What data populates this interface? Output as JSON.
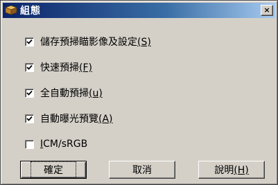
{
  "window": {
    "title": "組態",
    "close_label": "×"
  },
  "options": [
    {
      "label_prefix": "儲存預掃瞄影像及設定",
      "mnemonic": "(S)",
      "checked": true
    },
    {
      "label_prefix": "快速預掃",
      "mnemonic": "(F)",
      "checked": true
    },
    {
      "label_prefix": "全自動預掃",
      "mnemonic": "(u)",
      "checked": true
    },
    {
      "label_prefix": "自動曝光預覽",
      "mnemonic": "(A)",
      "checked": true
    },
    {
      "label_prefix": "",
      "mnemonic": "I",
      "label_suffix": "CM/sRGB",
      "checked": false
    }
  ],
  "buttons": {
    "ok": "確定",
    "cancel": "取消",
    "help_prefix": "說明",
    "help_mnemonic": "(H)"
  }
}
